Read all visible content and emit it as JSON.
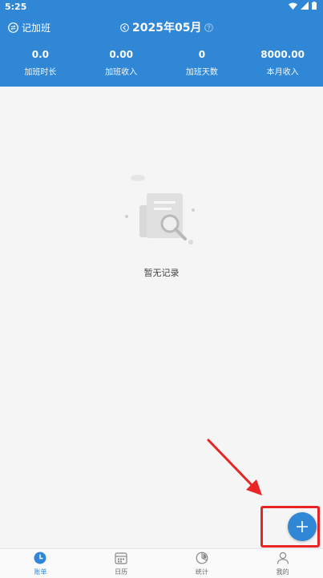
{
  "status_bar": {
    "time": "5:25"
  },
  "header": {
    "app_title": "记加班",
    "month": "2025年05月",
    "stats": [
      {
        "value": "0.0",
        "label": "加班时长"
      },
      {
        "value": "0.00",
        "label": "加班收入"
      },
      {
        "value": "0",
        "label": "加班天数"
      },
      {
        "value": "8000.00",
        "label": "本月收入"
      }
    ]
  },
  "empty_state": {
    "label": "暂无记录"
  },
  "tabs": [
    {
      "label": "账单",
      "icon": "clock-icon",
      "active": true
    },
    {
      "label": "日历",
      "icon": "calendar-icon",
      "active": false
    },
    {
      "label": "统计",
      "icon": "pie-chart-icon",
      "active": false
    },
    {
      "label": "我的",
      "icon": "person-icon",
      "active": false
    }
  ],
  "colors": {
    "primary": "#2f87d6",
    "highlight": "#e82424",
    "background": "#f5f5f5"
  }
}
